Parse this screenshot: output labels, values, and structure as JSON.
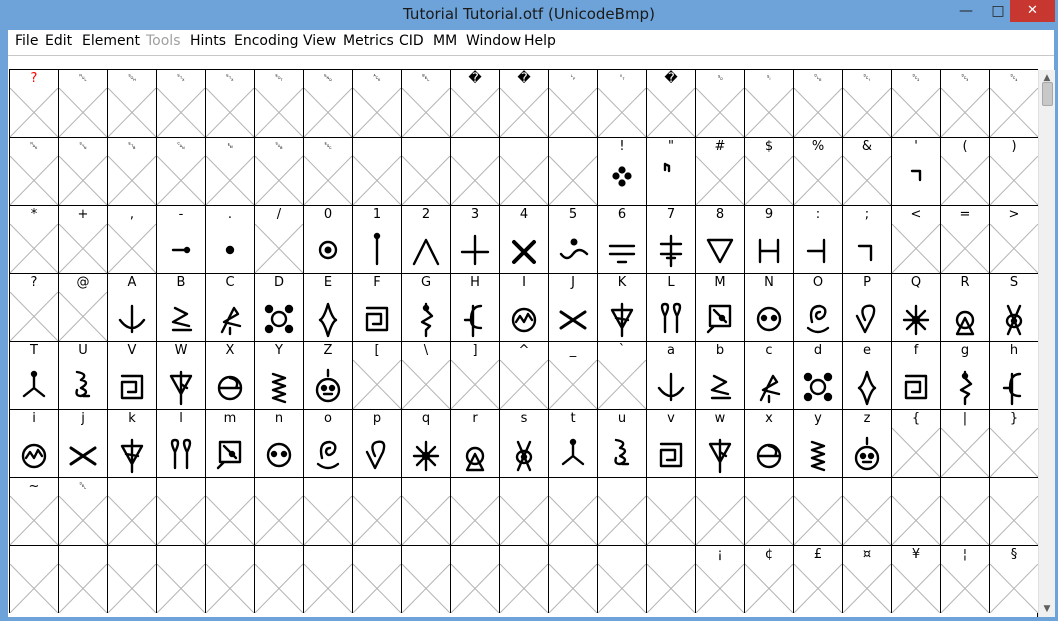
{
  "window": {
    "title": "Tutorial  Tutorial.otf (UnicodeBmp)",
    "minimize_label": "—",
    "maximize_label": "□",
    "close_label": "✕"
  },
  "menu": [
    {
      "label": "File",
      "disabled": false
    },
    {
      "label": "Edit",
      "disabled": false
    },
    {
      "label": "Element",
      "disabled": false
    },
    {
      "label": "Tools",
      "disabled": true
    },
    {
      "label": "Hints",
      "disabled": false
    },
    {
      "label": "Encoding",
      "disabled": false
    },
    {
      "label": "View",
      "disabled": false
    },
    {
      "label": "Metrics",
      "disabled": false
    },
    {
      "label": "CID",
      "disabled": false
    },
    {
      "label": "MM",
      "disabled": false
    },
    {
      "label": "Window",
      "disabled": false
    },
    {
      "label": "Help",
      "disabled": false
    }
  ],
  "scrollbar": {
    "up": "▲",
    "down": "▼"
  },
  "colors": {
    "missing_label": "#ff0000",
    "cell_border": "#000000",
    "empty_cross": "#b4b4b4"
  },
  "rows": [
    [
      {
        "label": "?",
        "kind": "notdef",
        "red": true
      },
      {
        "label": "␀",
        "kind": "empty",
        "box": true
      },
      {
        "label": "␁",
        "kind": "empty",
        "box": true
      },
      {
        "label": "␂",
        "kind": "empty",
        "box": true
      },
      {
        "label": "␃",
        "kind": "empty",
        "box": true
      },
      {
        "label": "␄",
        "kind": "empty",
        "box": true
      },
      {
        "label": "␅",
        "kind": "empty",
        "box": true
      },
      {
        "label": "␆",
        "kind": "empty",
        "box": true
      },
      {
        "label": "␇",
        "kind": "empty",
        "box": true
      },
      {
        "label": "�",
        "kind": "empty"
      },
      {
        "label": "�",
        "kind": "empty"
      },
      {
        "label": "␊",
        "kind": "empty",
        "box": true
      },
      {
        "label": "␋",
        "kind": "empty",
        "box": true
      },
      {
        "label": "�",
        "kind": "empty"
      },
      {
        "label": "␎",
        "kind": "empty",
        "box": true
      },
      {
        "label": "␏",
        "kind": "empty",
        "box": true
      },
      {
        "label": "␐",
        "kind": "empty",
        "box": true
      },
      {
        "label": "␑",
        "kind": "empty",
        "box": true
      },
      {
        "label": "␒",
        "kind": "empty",
        "box": true
      },
      {
        "label": "␓",
        "kind": "empty",
        "box": true
      },
      {
        "label": "␔",
        "kind": "empty",
        "box": true
      }
    ],
    [
      {
        "label": "␕",
        "kind": "empty",
        "box": true
      },
      {
        "label": "␖",
        "kind": "empty",
        "box": true
      },
      {
        "label": "␗",
        "kind": "empty",
        "box": true
      },
      {
        "label": "␘",
        "kind": "empty",
        "box": true
      },
      {
        "label": "␙",
        "kind": "empty",
        "box": true
      },
      {
        "label": "␚",
        "kind": "empty",
        "box": true
      },
      {
        "label": "␛",
        "kind": "empty",
        "box": true
      },
      {
        "label": "",
        "kind": "empty"
      },
      {
        "label": "",
        "kind": "empty"
      },
      {
        "label": "",
        "kind": "empty"
      },
      {
        "label": "",
        "kind": "empty"
      },
      {
        "label": "",
        "kind": "empty"
      },
      {
        "label": "!",
        "kind": "glyph",
        "glyph": "exclam"
      },
      {
        "label": "\"",
        "kind": "glyph",
        "glyph": "quotedbl"
      },
      {
        "label": "#",
        "kind": "empty"
      },
      {
        "label": "$",
        "kind": "empty"
      },
      {
        "label": "%",
        "kind": "empty"
      },
      {
        "label": "&",
        "kind": "empty"
      },
      {
        "label": "'",
        "kind": "glyph",
        "glyph": "quotesingle"
      },
      {
        "label": "(",
        "kind": "empty"
      },
      {
        "label": ")",
        "kind": "empty"
      }
    ],
    [
      {
        "label": "*",
        "kind": "empty"
      },
      {
        "label": "+",
        "kind": "empty"
      },
      {
        "label": ",",
        "kind": "empty"
      },
      {
        "label": "-",
        "kind": "glyph",
        "glyph": "hyphen"
      },
      {
        "label": ".",
        "kind": "glyph",
        "glyph": "period"
      },
      {
        "label": "/",
        "kind": "empty"
      },
      {
        "label": "0",
        "kind": "glyph",
        "glyph": "zero"
      },
      {
        "label": "1",
        "kind": "glyph",
        "glyph": "one"
      },
      {
        "label": "2",
        "kind": "glyph",
        "glyph": "two"
      },
      {
        "label": "3",
        "kind": "glyph",
        "glyph": "three"
      },
      {
        "label": "4",
        "kind": "glyph",
        "glyph": "four"
      },
      {
        "label": "5",
        "kind": "glyph",
        "glyph": "five"
      },
      {
        "label": "6",
        "kind": "glyph",
        "glyph": "six"
      },
      {
        "label": "7",
        "kind": "glyph",
        "glyph": "seven"
      },
      {
        "label": "8",
        "kind": "glyph",
        "glyph": "eight"
      },
      {
        "label": "9",
        "kind": "glyph",
        "glyph": "nine"
      },
      {
        "label": ":",
        "kind": "glyph",
        "glyph": "colon"
      },
      {
        "label": ";",
        "kind": "glyph",
        "glyph": "semicolon"
      },
      {
        "label": "<",
        "kind": "empty"
      },
      {
        "label": "=",
        "kind": "empty"
      },
      {
        "label": ">",
        "kind": "empty"
      }
    ],
    [
      {
        "label": "?",
        "kind": "empty"
      },
      {
        "label": "@",
        "kind": "empty"
      },
      {
        "label": "A",
        "kind": "glyph",
        "glyph": "A"
      },
      {
        "label": "B",
        "kind": "glyph",
        "glyph": "B"
      },
      {
        "label": "C",
        "kind": "glyph",
        "glyph": "C"
      },
      {
        "label": "D",
        "kind": "glyph",
        "glyph": "D"
      },
      {
        "label": "E",
        "kind": "glyph",
        "glyph": "E"
      },
      {
        "label": "F",
        "kind": "glyph",
        "glyph": "F"
      },
      {
        "label": "G",
        "kind": "glyph",
        "glyph": "G"
      },
      {
        "label": "H",
        "kind": "glyph",
        "glyph": "H"
      },
      {
        "label": "I",
        "kind": "glyph",
        "glyph": "I"
      },
      {
        "label": "J",
        "kind": "glyph",
        "glyph": "J"
      },
      {
        "label": "K",
        "kind": "glyph",
        "glyph": "K"
      },
      {
        "label": "L",
        "kind": "glyph",
        "glyph": "L"
      },
      {
        "label": "M",
        "kind": "glyph",
        "glyph": "M"
      },
      {
        "label": "N",
        "kind": "glyph",
        "glyph": "N"
      },
      {
        "label": "O",
        "kind": "glyph",
        "glyph": "O"
      },
      {
        "label": "P",
        "kind": "glyph",
        "glyph": "P"
      },
      {
        "label": "Q",
        "kind": "glyph",
        "glyph": "Q"
      },
      {
        "label": "R",
        "kind": "glyph",
        "glyph": "R"
      },
      {
        "label": "S",
        "kind": "glyph",
        "glyph": "S"
      }
    ],
    [
      {
        "label": "T",
        "kind": "glyph",
        "glyph": "T"
      },
      {
        "label": "U",
        "kind": "glyph",
        "glyph": "U"
      },
      {
        "label": "V",
        "kind": "glyph",
        "glyph": "V"
      },
      {
        "label": "W",
        "kind": "glyph",
        "glyph": "W"
      },
      {
        "label": "X",
        "kind": "glyph",
        "glyph": "X"
      },
      {
        "label": "Y",
        "kind": "glyph",
        "glyph": "Y"
      },
      {
        "label": "Z",
        "kind": "glyph",
        "glyph": "Z"
      },
      {
        "label": "[",
        "kind": "empty"
      },
      {
        "label": "\\",
        "kind": "empty"
      },
      {
        "label": "]",
        "kind": "empty"
      },
      {
        "label": "^",
        "kind": "empty"
      },
      {
        "label": "_",
        "kind": "empty"
      },
      {
        "label": "`",
        "kind": "empty"
      },
      {
        "label": "a",
        "kind": "glyph",
        "glyph": "A"
      },
      {
        "label": "b",
        "kind": "glyph",
        "glyph": "B"
      },
      {
        "label": "c",
        "kind": "glyph",
        "glyph": "C"
      },
      {
        "label": "d",
        "kind": "glyph",
        "glyph": "D"
      },
      {
        "label": "e",
        "kind": "glyph",
        "glyph": "E"
      },
      {
        "label": "f",
        "kind": "glyph",
        "glyph": "F"
      },
      {
        "label": "g",
        "kind": "glyph",
        "glyph": "G"
      },
      {
        "label": "h",
        "kind": "glyph",
        "glyph": "H"
      }
    ],
    [
      {
        "label": "i",
        "kind": "glyph",
        "glyph": "I"
      },
      {
        "label": "j",
        "kind": "glyph",
        "glyph": "J"
      },
      {
        "label": "k",
        "kind": "glyph",
        "glyph": "K"
      },
      {
        "label": "l",
        "kind": "glyph",
        "glyph": "L"
      },
      {
        "label": "m",
        "kind": "glyph",
        "glyph": "M"
      },
      {
        "label": "n",
        "kind": "glyph",
        "glyph": "N"
      },
      {
        "label": "o",
        "kind": "glyph",
        "glyph": "O"
      },
      {
        "label": "p",
        "kind": "glyph",
        "glyph": "P"
      },
      {
        "label": "q",
        "kind": "glyph",
        "glyph": "Q"
      },
      {
        "label": "r",
        "kind": "glyph",
        "glyph": "R"
      },
      {
        "label": "s",
        "kind": "glyph",
        "glyph": "S"
      },
      {
        "label": "t",
        "kind": "glyph",
        "glyph": "T"
      },
      {
        "label": "u",
        "kind": "glyph",
        "glyph": "U"
      },
      {
        "label": "v",
        "kind": "glyph",
        "glyph": "V"
      },
      {
        "label": "w",
        "kind": "glyph",
        "glyph": "W"
      },
      {
        "label": "x",
        "kind": "glyph",
        "glyph": "X"
      },
      {
        "label": "y",
        "kind": "glyph",
        "glyph": "Y"
      },
      {
        "label": "z",
        "kind": "glyph",
        "glyph": "Z"
      },
      {
        "label": "{",
        "kind": "empty"
      },
      {
        "label": "|",
        "kind": "empty"
      },
      {
        "label": "}",
        "kind": "empty"
      }
    ],
    [
      {
        "label": "~",
        "kind": "empty"
      },
      {
        "label": "␡",
        "kind": "empty",
        "box": true
      },
      {
        "label": "",
        "kind": "empty"
      },
      {
        "label": "",
        "kind": "empty"
      },
      {
        "label": "",
        "kind": "empty"
      },
      {
        "label": "",
        "kind": "empty"
      },
      {
        "label": "",
        "kind": "empty"
      },
      {
        "label": "",
        "kind": "empty"
      },
      {
        "label": "",
        "kind": "empty"
      },
      {
        "label": "",
        "kind": "empty"
      },
      {
        "label": "",
        "kind": "empty"
      },
      {
        "label": "",
        "kind": "empty"
      },
      {
        "label": "",
        "kind": "empty"
      },
      {
        "label": "",
        "kind": "empty"
      },
      {
        "label": "",
        "kind": "empty"
      },
      {
        "label": "",
        "kind": "empty"
      },
      {
        "label": "",
        "kind": "empty"
      },
      {
        "label": "",
        "kind": "empty"
      },
      {
        "label": "",
        "kind": "empty"
      },
      {
        "label": "",
        "kind": "empty"
      },
      {
        "label": "",
        "kind": "empty"
      }
    ],
    [
      {
        "label": "",
        "kind": "empty"
      },
      {
        "label": "",
        "kind": "empty"
      },
      {
        "label": "",
        "kind": "empty"
      },
      {
        "label": "",
        "kind": "empty"
      },
      {
        "label": "",
        "kind": "empty"
      },
      {
        "label": "",
        "kind": "empty"
      },
      {
        "label": "",
        "kind": "empty"
      },
      {
        "label": "",
        "kind": "empty"
      },
      {
        "label": "",
        "kind": "empty"
      },
      {
        "label": "",
        "kind": "empty"
      },
      {
        "label": "",
        "kind": "empty"
      },
      {
        "label": "",
        "kind": "empty"
      },
      {
        "label": "",
        "kind": "empty"
      },
      {
        "label": "",
        "kind": "empty"
      },
      {
        "label": "¡",
        "kind": "empty"
      },
      {
        "label": "¢",
        "kind": "empty"
      },
      {
        "label": "£",
        "kind": "empty"
      },
      {
        "label": "¤",
        "kind": "empty"
      },
      {
        "label": "¥",
        "kind": "empty"
      },
      {
        "label": "¦",
        "kind": "empty"
      },
      {
        "label": "§",
        "kind": "empty"
      }
    ]
  ]
}
